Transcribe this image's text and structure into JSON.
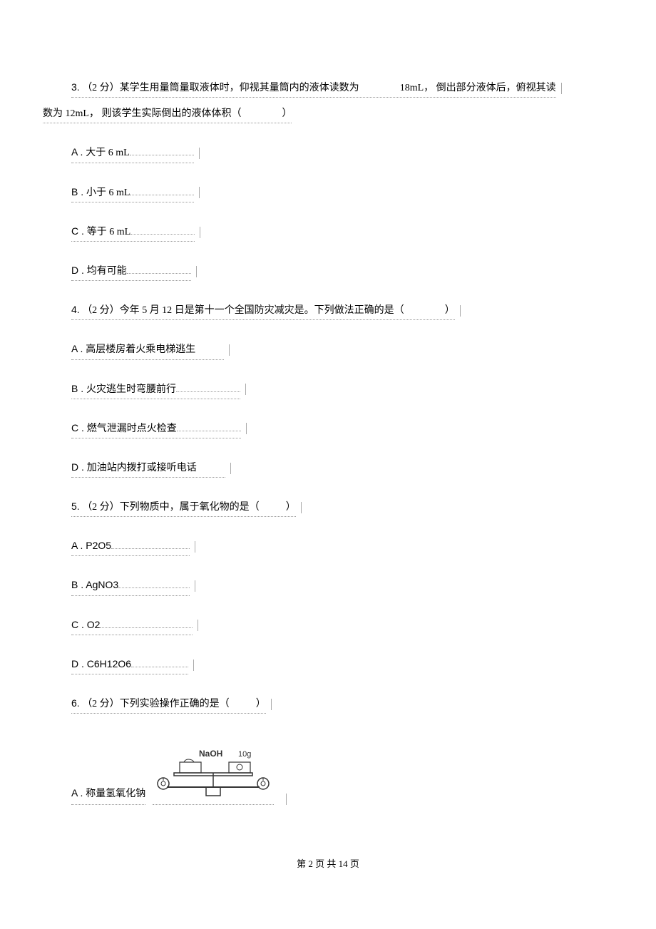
{
  "q3": {
    "number": "3.",
    "points": "（2 分）",
    "text_part1": "某学生用量筒量取液体时，仰视其量筒内的液体读数为",
    "value1": "18mL，",
    "text_part2": "倒出部分液体后，俯视其读",
    "line2_prefix": "数为",
    "value2": "12mL，",
    "line2_rest": "则该学生实际倒出的液体体积（",
    "paren_close": "）",
    "options": {
      "A": "大于 6 mL",
      "B": "小于 6 mL",
      "C": "等于 6 mL",
      "D": "均有可能"
    }
  },
  "q4": {
    "number": "4.",
    "points": "（2 分）",
    "text_part1": "今年",
    "date": "5 月 12",
    "text_part2": "日是第十一个全国防灾减灾是。下列做法正确的是（",
    "paren_close": "）",
    "options": {
      "A": "高层楼房着火乘电梯逃生",
      "B": "火灾逃生时弯腰前行",
      "C": "燃气泄漏时点火检查",
      "D": "加油站内拨打或接听电话"
    }
  },
  "q5": {
    "number": "5.",
    "points": "（2 分）",
    "text": "下列物质中，属于氧化物的是（",
    "paren_close": "）",
    "options": {
      "A": "A . P2O5",
      "B": "B . AgNO3",
      "C": "C . O2",
      "D": "D . C6H12O6"
    }
  },
  "q6": {
    "number": "6.",
    "points": "（2 分）",
    "text": "下列实验操作正确的是（",
    "paren_close": "）",
    "options": {
      "A": "称量氢氧化钠"
    },
    "image_labels": {
      "naoh": "NaOH",
      "weight": "10g"
    }
  },
  "footer": "第 2 页 共 14 页"
}
